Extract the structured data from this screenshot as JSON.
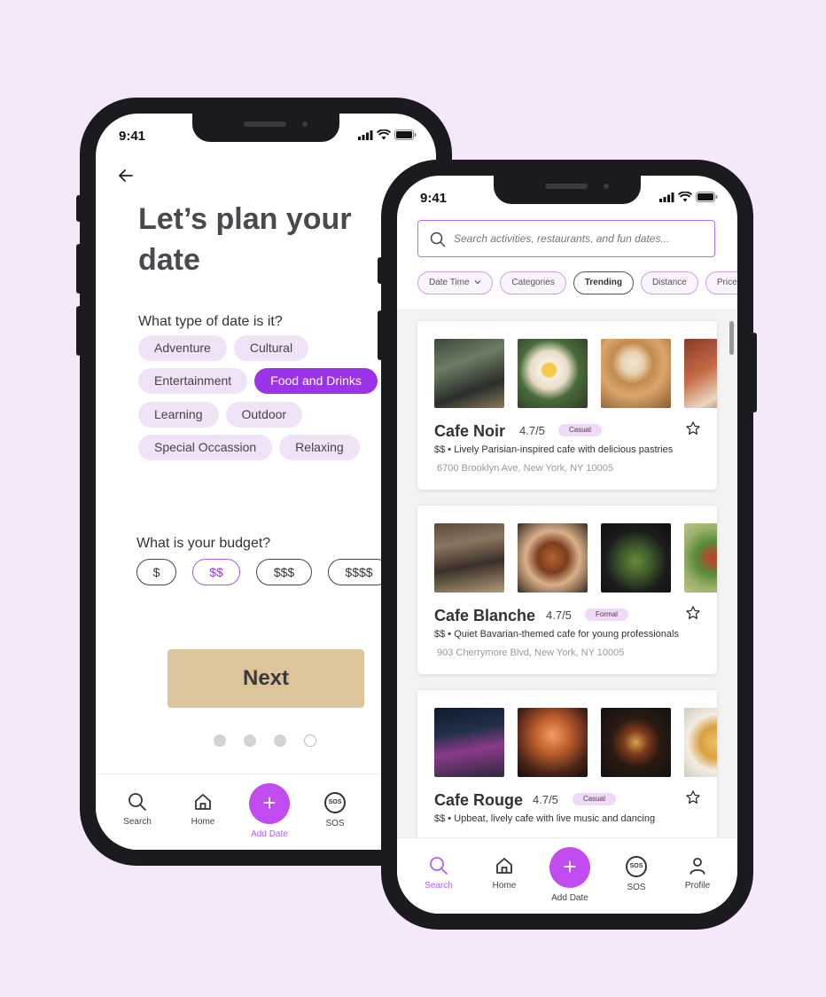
{
  "colors": {
    "background": "#f6e8fb",
    "accent": "#9b33e8",
    "fab": "#c14cf0",
    "next_button": "#dcc59a"
  },
  "phone1": {
    "status_time": "9:41",
    "title": "Let’s plan your date",
    "date_type_question": "What type of date is it?",
    "date_types": [
      {
        "label": "Adventure",
        "selected": false
      },
      {
        "label": "Cultural",
        "selected": false
      },
      {
        "label": "Entertainment",
        "selected": false
      },
      {
        "label": "Food and Drinks",
        "selected": true
      },
      {
        "label": "Learning",
        "selected": false
      },
      {
        "label": "Outdoor",
        "selected": false
      },
      {
        "label": "Special Occassion",
        "selected": false
      },
      {
        "label": "Relaxing",
        "selected": false
      }
    ],
    "budget_question": "What is your budget?",
    "budget_options": [
      {
        "label": "$",
        "selected": false
      },
      {
        "label": "$$",
        "selected": true
      },
      {
        "label": "$$$",
        "selected": false
      },
      {
        "label": "$$$$",
        "selected": false
      }
    ],
    "next_label": "Next",
    "progress": {
      "current_step": 3,
      "total_steps": 4
    },
    "nav": {
      "search": "Search",
      "home": "Home",
      "add": "Add Date",
      "sos": "SOS",
      "sos_icon_text": "SOS"
    }
  },
  "phone2": {
    "status_time": "9:41",
    "search_placeholder": "Search activities, restaurants, and fun dates...",
    "filters": {
      "date_time": "Date Time",
      "categories": "Categories",
      "trending": "Trending",
      "distance": "Distance",
      "price": "Price"
    },
    "cards": [
      {
        "name": "Cafe Noir",
        "rating": "4.7/5",
        "tag": "Casual",
        "price": "$$",
        "description": "Lively Parisian-inspired cafe with delicious pastries",
        "address": "6700 Brooklyn Ave, New York, NY 10005"
      },
      {
        "name": "Cafe Blanche",
        "rating": "4.7/5",
        "tag": "Formal",
        "price": "$$",
        "description": "Quiet Bavarian-themed cafe for young professionals",
        "address": "903 Cherrymore Blvd, New York, NY 10005"
      },
      {
        "name": "Cafe Rouge",
        "rating": "4.7/5",
        "tag": "Casual",
        "price": "$$",
        "description": "Upbeat, lively cafe with live music and dancing",
        "address": ""
      }
    ],
    "nav": {
      "search": "Search",
      "home": "Home",
      "add": "Add Date",
      "sos": "SOS",
      "profile": "Profile",
      "sos_icon_text": "SOS"
    }
  }
}
